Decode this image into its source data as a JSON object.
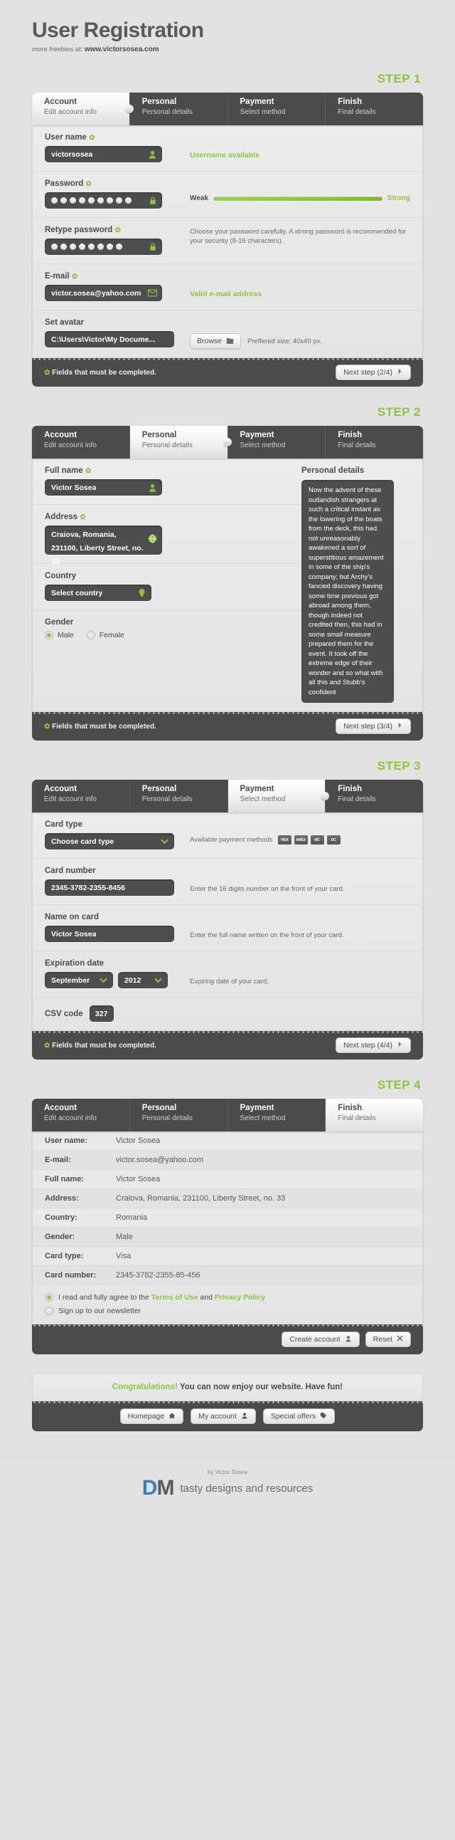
{
  "header": {
    "title": "User Registration",
    "subtitle_prefix": "more freebies at: ",
    "subtitle_site": "www.victorsosea.com"
  },
  "tabs": [
    {
      "title": "Account",
      "sub": "Edit account info"
    },
    {
      "title": "Personal",
      "sub": "Personal details"
    },
    {
      "title": "Payment",
      "sub": "Select method"
    },
    {
      "title": "Finish",
      "sub": "Final details"
    }
  ],
  "required_note": "Fields that must be completed.",
  "required_marker": "✿",
  "steps": {
    "step1": {
      "label": "STEP 1",
      "active_tab": 0,
      "fields": {
        "username_label": "User name",
        "username_value": "victorsosea",
        "username_status": "Username available",
        "password_label": "Password",
        "password_dots": 9,
        "strength_weak": "Weak",
        "strength_strong": "Strong",
        "retype_label": "Retype password",
        "retype_dots": 8,
        "password_hint": "Choose your password carefully. A strong password is recommended for your security (8-16 characters).",
        "email_label": "E-mail",
        "email_value": "victor.sosea@yahoo.com",
        "email_status": "Valid e-mail address",
        "avatar_label": "Set avatar",
        "avatar_value": "C:\\Users\\Victor\\My Docume...",
        "browse_label": "Browse",
        "avatar_hint": "Preffered size: 40x40 px."
      },
      "next_label": "Next step (2/4)"
    },
    "step2": {
      "label": "STEP 2",
      "active_tab": 1,
      "fields": {
        "fullname_label": "Full name",
        "fullname_value": "Victor Sosea",
        "address_label": "Address",
        "address_value": "Craiova, Romania, 231100, Liberty Street, no. 33",
        "country_label": "Country",
        "country_value": "Select country",
        "gender_label": "Gender",
        "gender_male": "Male",
        "gender_female": "Female",
        "gender_selected": "Male",
        "details_title": "Personal details",
        "details_text": "Now the advent of these outlandish strangers at such a critical instant as the lowering of the boats from the deck, this had not unreasonably awakened a sort of superstitious amazement in some of the ship's company; but Archy's fancied discovery having some time previous got abroad among them, though indeed not credited then, this had in some small measure prepared them for the event. It took off the extreme edge of their wonder and so what with all this and Stubb's confident"
      },
      "next_label": "Next step (3/4)"
    },
    "step3": {
      "label": "STEP 3",
      "active_tab": 2,
      "fields": {
        "cardtype_label": "Card type",
        "cardtype_value": "Choose card type",
        "cardtype_hint": "Available payment methods",
        "card_brands": [
          "VISA",
          "AMEX",
          "MC",
          "DC"
        ],
        "cardnumber_label": "Card number",
        "cardnumber_value": "2345-3782-2355-8456",
        "cardnumber_hint": "Enter the 16 digits number on the front of your card.",
        "nameoncard_label": "Name on card",
        "nameoncard_value": "Victor Sosea",
        "nameoncard_hint": "Enter the full name written on the front of your card.",
        "expiration_label": "Expiration date",
        "expiration_month": "September",
        "expiration_year": "2012",
        "expiration_hint": "Expiring date of your card.",
        "csv_label": "CSV code",
        "csv_value": "327"
      },
      "next_label": "Next step (4/4)"
    },
    "step4": {
      "label": "STEP 4",
      "active_tab": 3,
      "summary": [
        {
          "key": "User name:",
          "value": "Victor Sosea"
        },
        {
          "key": "E-mail:",
          "value": "victor.sosea@yahoo.com"
        },
        {
          "key": "Full name:",
          "value": "Victor Sosea"
        },
        {
          "key": "Address:",
          "value": "Craiova, Romania, 231100, Liberty Street, no. 33"
        },
        {
          "key": "Country:",
          "value": "Romania"
        },
        {
          "key": "Gender:",
          "value": "Male"
        },
        {
          "key": "Card type:",
          "value": "Visa"
        },
        {
          "key": "Card number:",
          "value": "2345-3782-2355-85-456"
        }
      ],
      "agree_pre": "I read and fully agree to the ",
      "agree_terms": "Terms of Use",
      "agree_mid": " and ",
      "agree_privacy": "Privacy Policy",
      "newsletter": "Sign up to our newsletter",
      "create_label": "Create account",
      "reset_label": "Reset"
    }
  },
  "congrats": {
    "highlight": "Congratulations!",
    "message": " You can now enjoy our website. Have fun!",
    "buttons": [
      "Homepage",
      "My account",
      "Special offers"
    ]
  },
  "brand": {
    "by": "by Victor Sosea",
    "logo_left": "D",
    "logo_right": "M",
    "tagline": "tasty designs and resources"
  },
  "colors": {
    "accent": "#8cc63e",
    "dark": "#4b4b4b",
    "page_bg": "#e2e2e2"
  }
}
